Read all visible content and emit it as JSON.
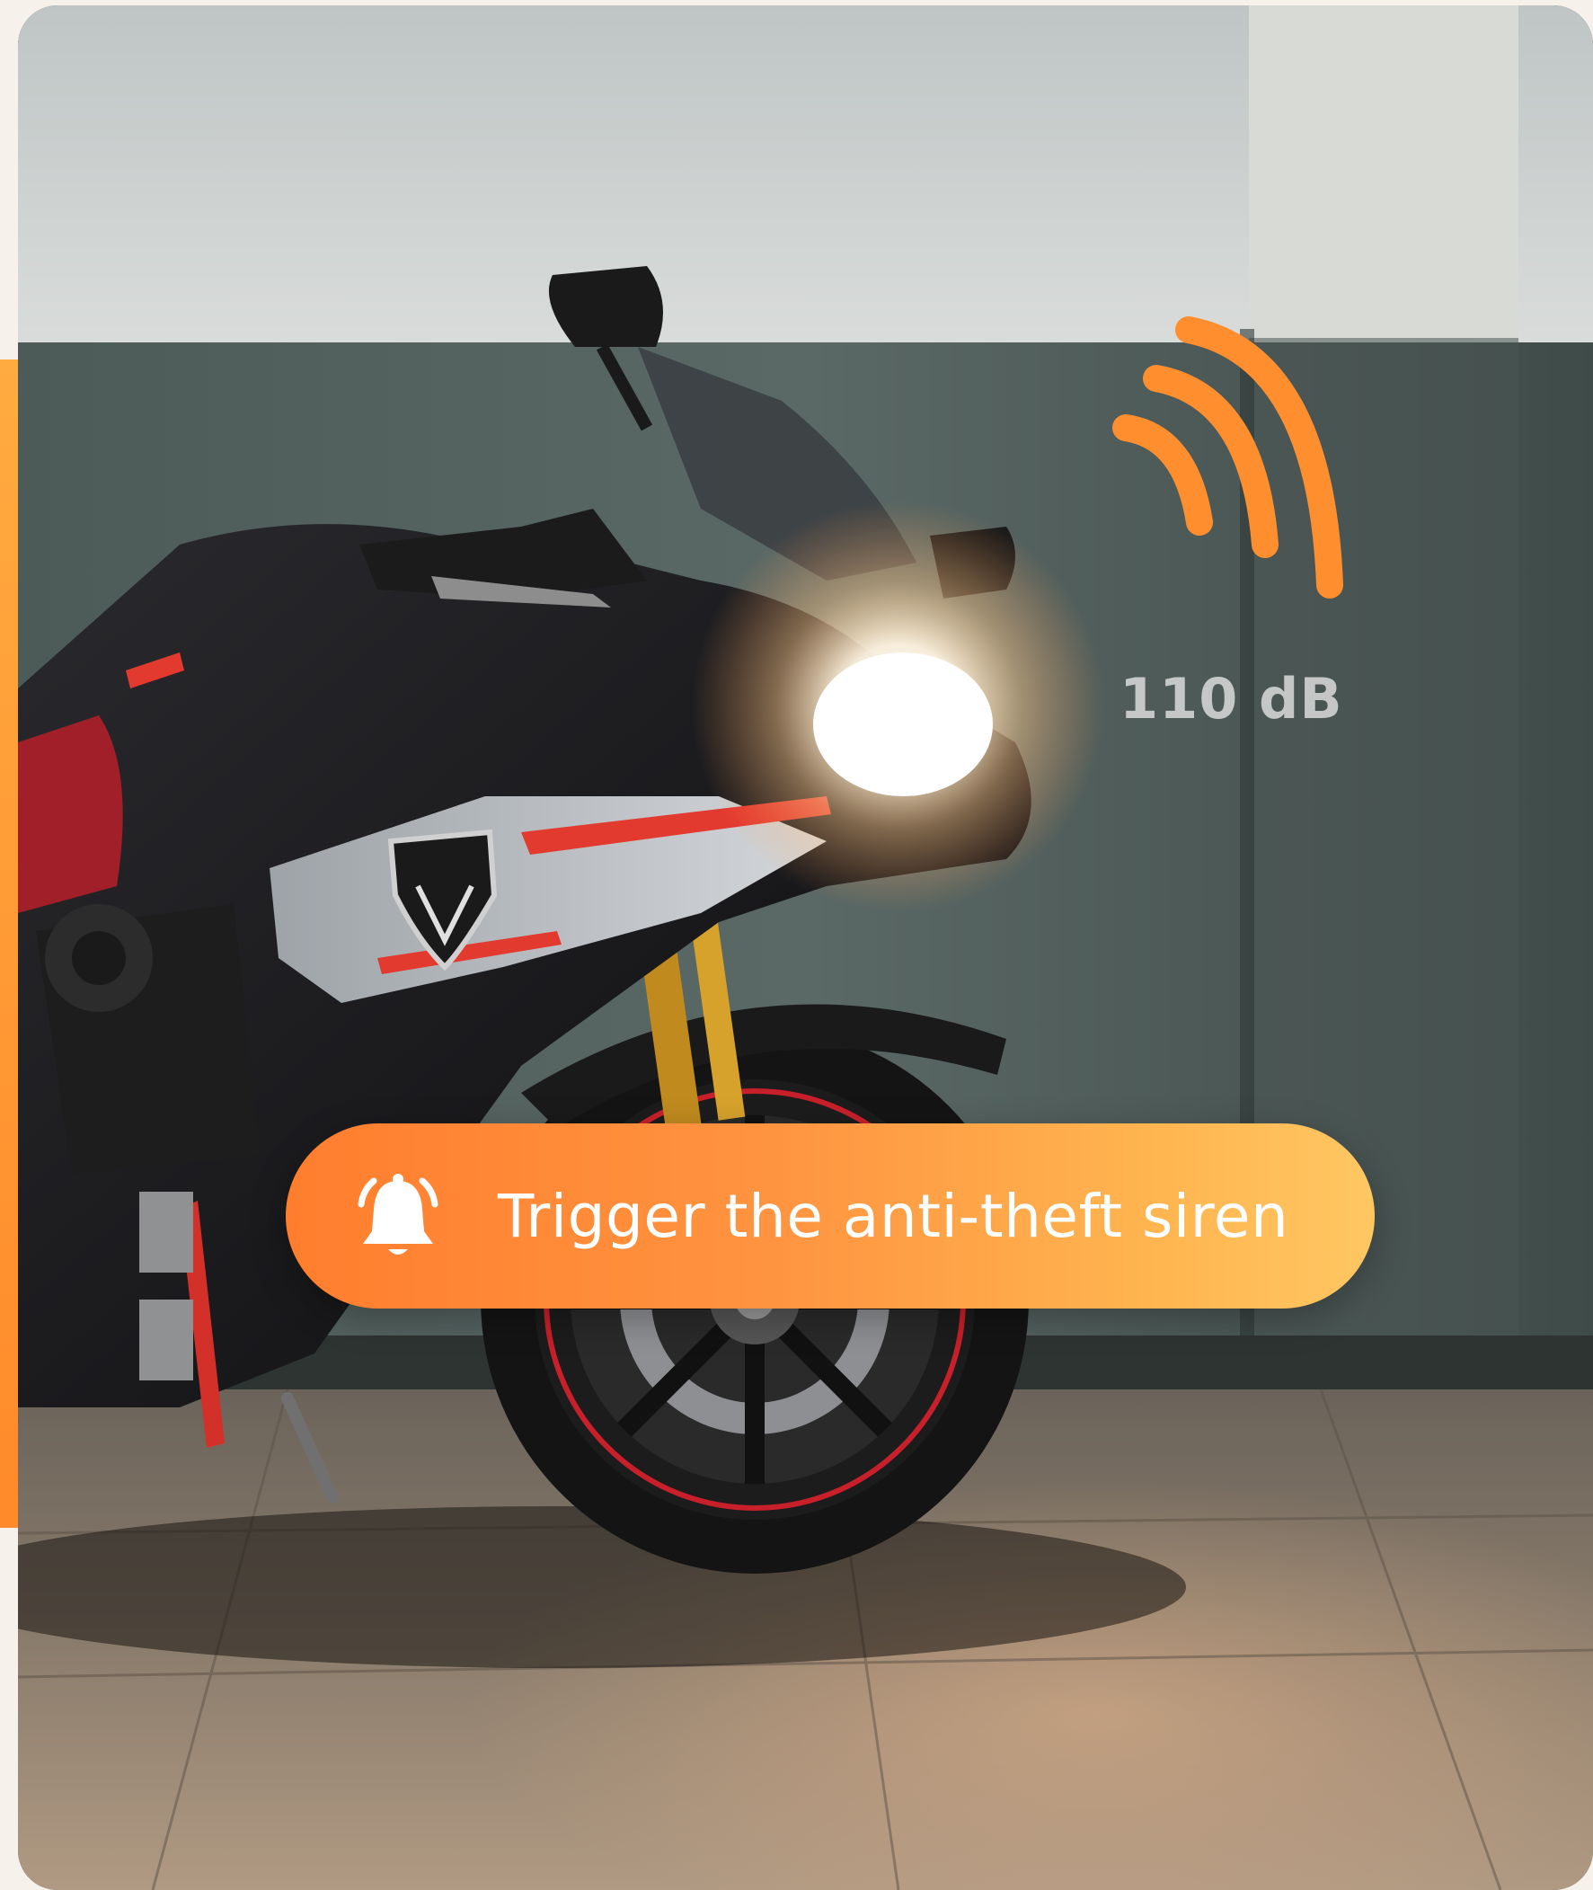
{
  "photo": {
    "subject": "motorcycle-photo"
  },
  "sound": {
    "icon": "sound-waves-icon",
    "level_label": "110 dB"
  },
  "siren_button": {
    "icon": "bell-ringing-icon",
    "label": "Trigger the anti-theft siren"
  },
  "colors": {
    "accent_start": "#ff7e2e",
    "accent_end": "#ffc762",
    "wave": "#ff8f2e"
  }
}
